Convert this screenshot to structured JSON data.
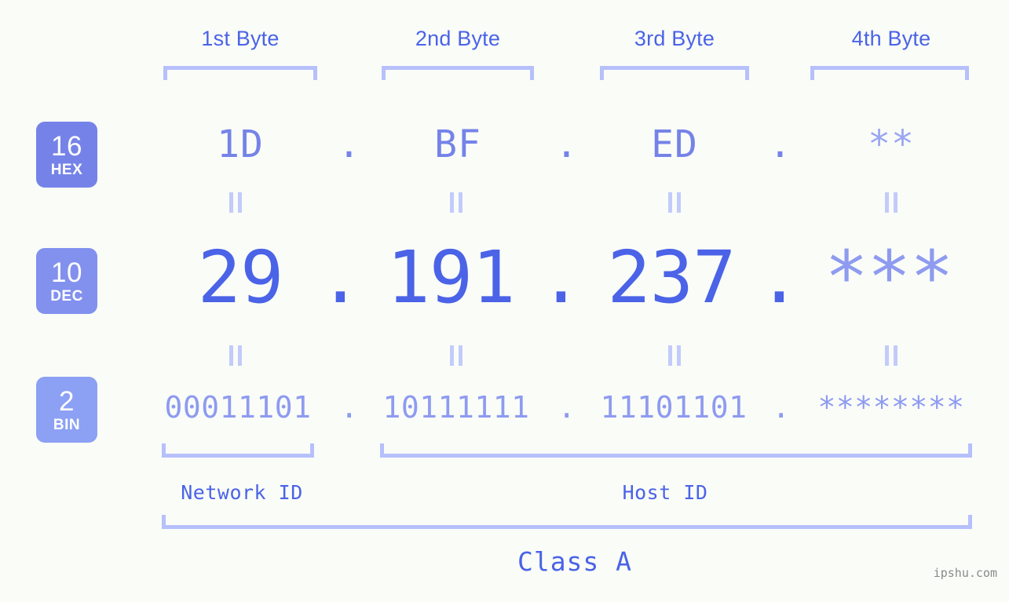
{
  "background_color": "#fafcf8",
  "colors": {
    "bracket": "#b6c0fb",
    "hex_text": "#7583e8",
    "dec_text": "#4a63e7",
    "bin_text": "#8e9bf0",
    "badge_hex": "#7583e8",
    "badge_dec": "#8291ee",
    "badge_bin": "#8ca0f4",
    "header_label": "#4a63e7",
    "watermark": "#8a8a8a"
  },
  "headers": {
    "bytes": [
      {
        "label": "1st Byte"
      },
      {
        "label": "2nd Byte"
      },
      {
        "label": "3rd Byte"
      },
      {
        "label": "4th Byte"
      }
    ]
  },
  "badges": [
    {
      "num": "16",
      "name": "HEX"
    },
    {
      "num": "10",
      "name": "DEC"
    },
    {
      "num": "2",
      "name": "BIN"
    }
  ],
  "rows": {
    "hex": {
      "values": [
        "1D",
        "BF",
        "ED",
        "**"
      ],
      "separator": ".",
      "masked_index": 3
    },
    "dec": {
      "values": [
        "29",
        "191",
        "237",
        "***"
      ],
      "separator": ".",
      "masked_index": 3
    },
    "bin": {
      "values": [
        "00011101",
        "10111111",
        "11101101",
        "********"
      ],
      "separator": ".",
      "masked_index": 3
    }
  },
  "connectors": {
    "symbol": "equals-rotated"
  },
  "sections": [
    {
      "label": "Network ID"
    },
    {
      "label": "Host ID"
    }
  ],
  "class": {
    "label": "Class A"
  },
  "watermark": {
    "text": "ipshu.com"
  }
}
